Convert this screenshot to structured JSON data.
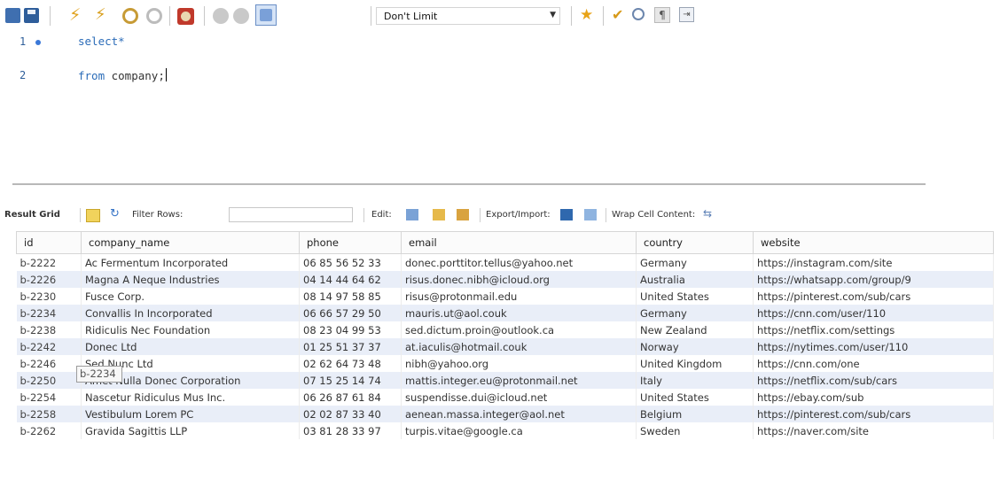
{
  "toolbar": {
    "limit_value": "Don't Limit",
    "icons": [
      "open-file-icon",
      "save-icon",
      "execute-icon",
      "execute-current-icon",
      "explain-icon",
      "stop-icon",
      "toggle-error-icon",
      "commit-icon",
      "rollback-icon",
      "autocommit-icon",
      "beautify-icon",
      "add-snippet-icon",
      "find-icon",
      "invisible-chars-icon",
      "wrap-icon"
    ]
  },
  "editor": {
    "lines": [
      {
        "number": "1",
        "keyword": "select*",
        "rest": ""
      },
      {
        "number": "2",
        "keyword": "from",
        "rest": " company;"
      }
    ]
  },
  "result_toolbar": {
    "grid_label": "Result Grid",
    "filter_label": "Filter Rows:",
    "filter_value": "",
    "edit_label": "Edit:",
    "export_label": "Export/Import:",
    "wrap_label": "Wrap Cell Content:"
  },
  "grid": {
    "columns": [
      "id",
      "company_name",
      "phone",
      "email",
      "country",
      "website"
    ],
    "rows": [
      [
        "b-2222",
        "Ac Fermentum Incorporated",
        "06 85 56 52 33",
        "donec.porttitor.tellus@yahoo.net",
        "Germany",
        "https://instagram.com/site"
      ],
      [
        "b-2226",
        "Magna A Neque Industries",
        "04 14 44 64 62",
        "risus.donec.nibh@icloud.org",
        "Australia",
        "https://whatsapp.com/group/9"
      ],
      [
        "b-2230",
        "Fusce Corp.",
        "08 14 97 58 85",
        "risus@protonmail.edu",
        "United States",
        "https://pinterest.com/sub/cars"
      ],
      [
        "b-2234",
        "Convallis In Incorporated",
        "06 66 57 29 50",
        "mauris.ut@aol.couk",
        "Germany",
        "https://cnn.com/user/110"
      ],
      [
        "b-2238",
        "Ridiculis Nec Foundation",
        "08 23 04 99 53",
        "sed.dictum.proin@outlook.ca",
        "New Zealand",
        "https://netflix.com/settings"
      ],
      [
        "b-2242",
        "Donec Ltd",
        "01 25 51 37 37",
        "at.iaculis@hotmail.couk",
        "Norway",
        "https://nytimes.com/user/110"
      ],
      [
        "b-2246",
        "Sed Nunc Ltd",
        "02 62 64 73 48",
        "nibh@yahoo.org",
        "United Kingdom",
        "https://cnn.com/one"
      ],
      [
        "b-2250",
        "Amet Nulla Donec Corporation",
        "07 15 25 14 74",
        "mattis.integer.eu@protonmail.net",
        "Italy",
        "https://netflix.com/sub/cars"
      ],
      [
        "b-2254",
        "Nascetur Ridiculus Mus Inc.",
        "06 26 87 61 84",
        "suspendisse.dui@icloud.net",
        "United States",
        "https://ebay.com/sub"
      ],
      [
        "b-2258",
        "Vestibulum Lorem PC",
        "02 02 87 33 40",
        "aenean.massa.integer@aol.net",
        "Belgium",
        "https://pinterest.com/sub/cars"
      ],
      [
        "b-2262",
        "Gravida Sagittis LLP",
        "03 81 28 33 97",
        "turpis.vitae@google.ca",
        "Sweden",
        "https://naver.com/site"
      ]
    ],
    "tooltip": "b-2234"
  }
}
